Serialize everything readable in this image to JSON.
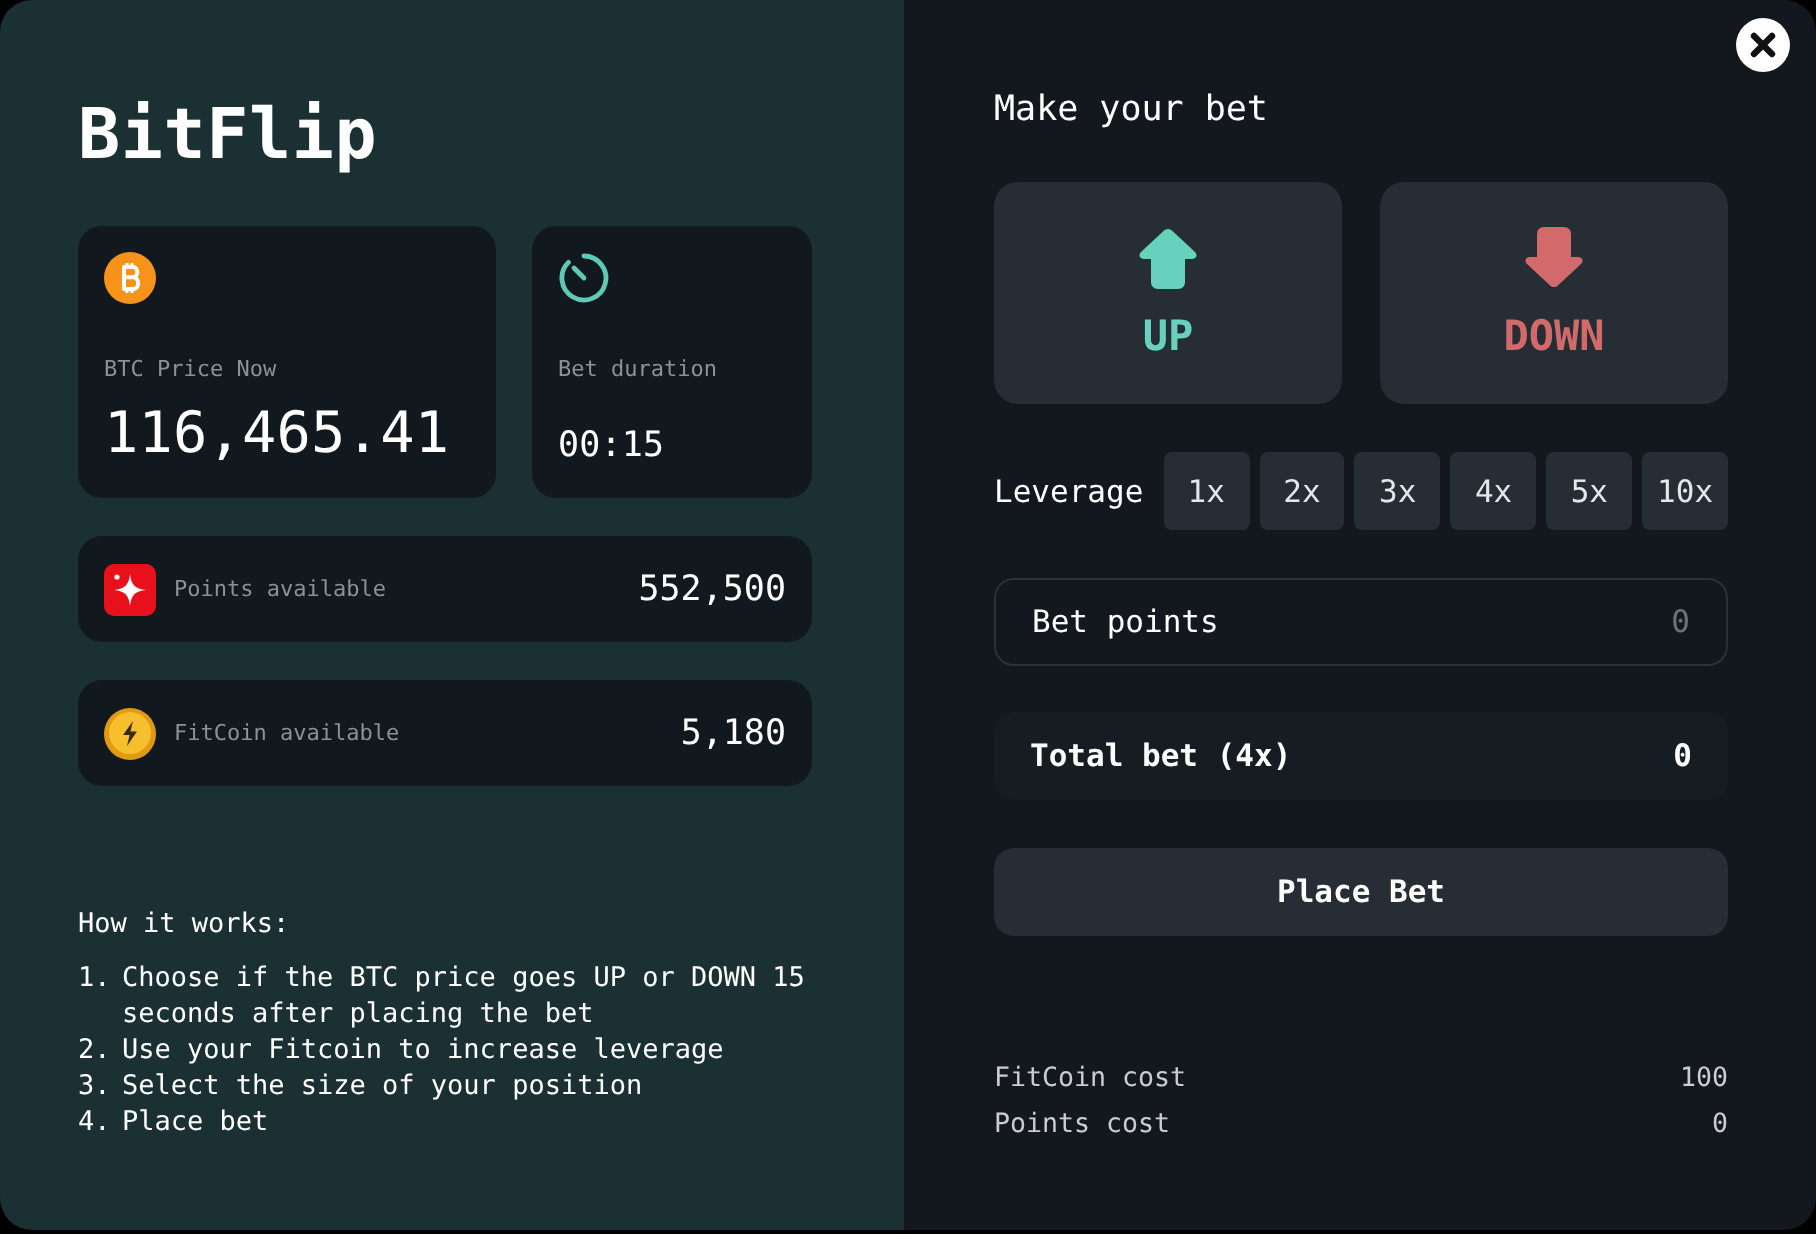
{
  "title": "BitFlip",
  "stats": [
    {
      "kind": "btc",
      "label": "BTC Price Now",
      "value": "116,465.41"
    },
    {
      "kind": "timer",
      "label": "Bet duration",
      "value": "00:15"
    }
  ],
  "balances": [
    {
      "kind": "points",
      "label": "Points available",
      "value": "552,500"
    },
    {
      "kind": "fitcoin",
      "label": "FitCoin available",
      "value": "5,180"
    }
  ],
  "how_it_works": {
    "heading": "How it works:",
    "steps": [
      {
        "number": "1.",
        "text": "Choose if the BTC price goes UP or DOWN 15 seconds after placing the bet"
      },
      {
        "number": "2.",
        "text": "Use your Fitcoin to increase leverage"
      },
      {
        "number": "3.",
        "text": "Select the size of your position"
      },
      {
        "number": "4.",
        "text": "Place bet"
      }
    ]
  },
  "bet": {
    "heading": "Make your bet",
    "directions": [
      {
        "kind": "up",
        "label": "UP"
      },
      {
        "kind": "down",
        "label": "DOWN"
      }
    ],
    "leverage": {
      "label": "Leverage",
      "options": [
        {
          "label": "1x",
          "selected": false
        },
        {
          "label": "2x",
          "selected": false
        },
        {
          "label": "3x",
          "selected": false
        },
        {
          "label": "4x",
          "selected": false
        },
        {
          "label": "5x",
          "selected": false
        },
        {
          "label": "10x",
          "selected": false
        }
      ]
    },
    "bet_points": {
      "label": "Bet points",
      "placeholder": "0"
    },
    "total": {
      "label": "Total bet (4x)",
      "value": "0"
    },
    "place_button": "Place Bet",
    "costs": [
      {
        "label": "FitCoin cost",
        "value": "100"
      },
      {
        "label": "Points cost",
        "value": "0"
      }
    ]
  }
}
